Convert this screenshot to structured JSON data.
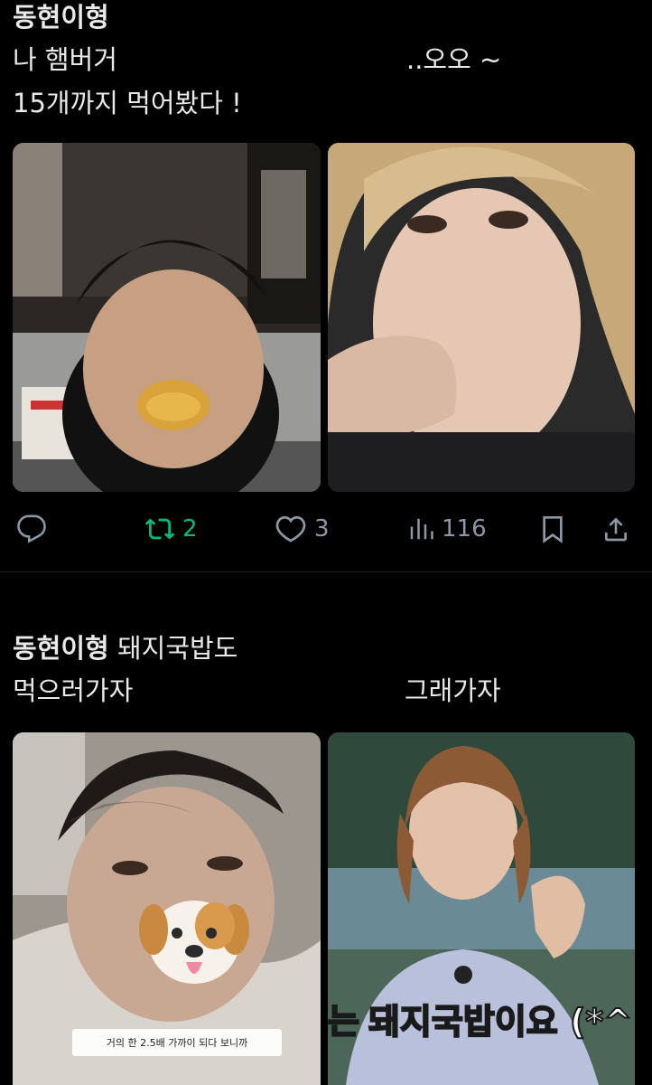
{
  "posts": [
    {
      "line1_name": "동현이형",
      "line2_left": "나 햄버거",
      "line2_right": "..오오 ~",
      "line3_left": "15개까지 먹어봤다 !",
      "actions": {
        "retweet_count": "2",
        "like_count": "3",
        "view_count": "116"
      },
      "colors": {
        "retweet_active": "#00ba7c",
        "icon_gray": "#8b98a5"
      }
    },
    {
      "line1_name": "동현이형",
      "line1_rest": "돼지국밥도",
      "line2_left": "먹으러가자",
      "line2_right": "그래가자",
      "left_image_caption": "거의 한 2.5배 가까이 되다 보니까",
      "right_image_subtitle_highlight": "돼지국밥",
      "right_image_subtitle_rest": "이요 (*^",
      "right_image_subtitle_prefix": "는"
    }
  ]
}
